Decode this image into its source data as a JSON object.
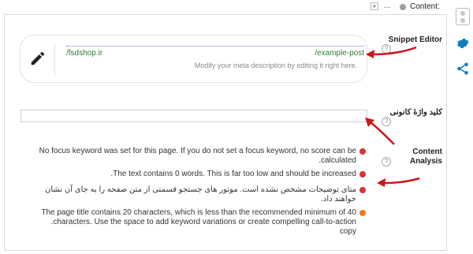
{
  "tabbar": {
    "add": "+",
    "more": "...",
    "label": "Content:"
  },
  "snippet": {
    "label": "Snippet Editor",
    "url_base": "/fsdshop.ir",
    "url_slug": "/example-post",
    "description": "Modify your meta description by editing it right here."
  },
  "keyword": {
    "label": "کلید واژهٔ کانونی",
    "value": ""
  },
  "analysis": {
    "label_line1": "Content",
    "label_line2": "Analysis",
    "help": "?",
    "items": [
      {
        "line1": "No focus keyword was set for this page. If you do not set a focus keyword, no score can be",
        "line2": ".calculated",
        "color": "red"
      },
      {
        "line1": ".The text contains 0 words. This is far too low and should be increased",
        "line2": "",
        "color": "red"
      },
      {
        "line1": "متای توضیحات مشخص نشده است. موتور های جستجو قسمتی از متن صفحه را به جای آن نشان",
        "line2": ".خواهند داد",
        "color": "red"
      },
      {
        "line1": "The page title contains 20 characters, which is less than the recommended minimum of 40",
        "line2": ".characters. Use the space to add keyword variations or create compelling call-to-action copy",
        "color": "orange"
      }
    ]
  },
  "colors": {
    "red_bullet": "#dc3232",
    "orange_bullet": "#ee7c1b",
    "url_green": "#2e7d32",
    "sidebar_blue": "#0a7ec2",
    "arrow_red": "#d0141c"
  },
  "sidebar": {
    "icons": [
      "traffic-light-icon",
      "gear-icon",
      "share-icon"
    ]
  }
}
